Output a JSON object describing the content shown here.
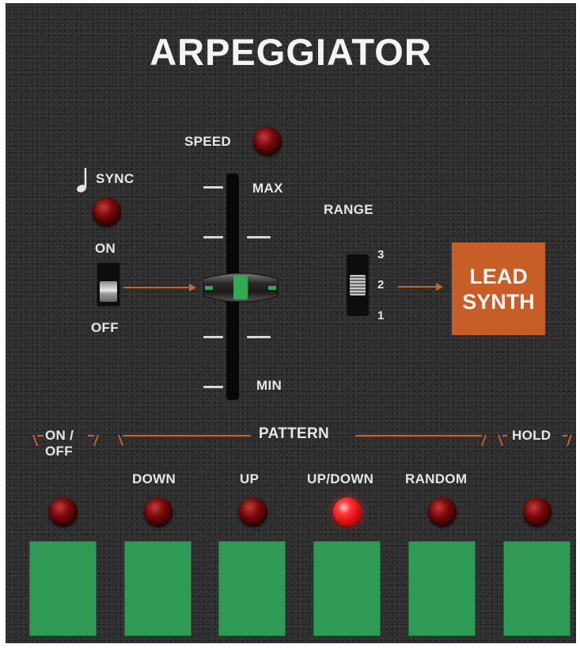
{
  "title": "ARPEGGIATOR",
  "sync": {
    "label": "SYNC",
    "note_icon": "quarter-note-icon",
    "on_label": "ON",
    "off_label": "OFF",
    "state": "off"
  },
  "speed": {
    "label": "SPEED",
    "max_label": "MAX",
    "min_label": "MIN",
    "level": 0.5
  },
  "range": {
    "label": "RANGE",
    "options": [
      "3",
      "2",
      "1"
    ],
    "selected": "2"
  },
  "lead_synth": {
    "line1": "LEAD",
    "line2": "SYNTH"
  },
  "pattern_label": "PATTERN",
  "onoff_label_top": "ON /",
  "onoff_label_bottom": "OFF",
  "hold_label": "HOLD",
  "patterns": [
    "DOWN",
    "UP",
    "UP/DOWN",
    "RANDOM"
  ],
  "active_pattern": "UP/DOWN",
  "colors": {
    "panel": "#2b2b2b",
    "accent": "#c85e27",
    "pad": "#2f9a55",
    "led_on": "#ff3a3a",
    "led_off": "#5a0707"
  }
}
